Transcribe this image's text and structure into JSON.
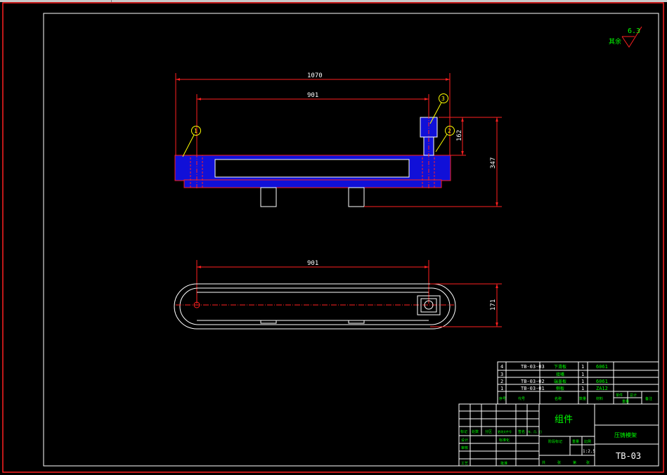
{
  "colors": {
    "background": "#000000",
    "border": "#ffffff",
    "sheet_frame": "#ff2020",
    "part_fill": "#1010d8",
    "dimension": "#ff2020",
    "outline": "#ffffff",
    "balloon": "#ffff00",
    "label_text": "#00ff00",
    "roughness_text": "#00ff00"
  },
  "roughness": {
    "value": "6.3",
    "label": "其余"
  },
  "dimensions": {
    "overall_length": "1070",
    "pitch_top": "901",
    "pitch_plan": "901",
    "height_stem": "162",
    "height_total": "347",
    "width_plan": "171"
  },
  "balloons": {
    "b1": "1",
    "b2": "2",
    "b3": "3"
  },
  "parts_list": [
    {
      "no": "4",
      "code": "TB-03-03",
      "name": "下滑板",
      "qty": "1",
      "material": "6061"
    },
    {
      "no": "3",
      "code": "",
      "name": "接嘴",
      "qty": "1",
      "material": ""
    },
    {
      "no": "2",
      "code": "TB-03-02",
      "name": "端盖板",
      "qty": "1",
      "material": "6061"
    },
    {
      "no": "1",
      "code": "TB-03-01",
      "name": "侧板",
      "qty": "1",
      "material": "ZA12"
    }
  ],
  "parts_header": {
    "no": "序号",
    "code": "代号",
    "name": "名称",
    "qty": "数量",
    "material": "材料",
    "unit": "单件",
    "total": "总计",
    "weight": "重量",
    "remark": "备注"
  },
  "title_block": {
    "title": "组件",
    "company": "压铸模架",
    "drawing_no": "TB-03",
    "scale": "1:2.5",
    "rev_mark": "标记",
    "rev_count": "处数",
    "rev_zone": "分区",
    "rev_doc": "更改文件号",
    "rev_sign": "签名",
    "rev_date": "年、月、日",
    "designer": "设计",
    "standardize": "标准化",
    "checker": "审核",
    "process": "工艺",
    "approve": "批准",
    "stage_mark": "阶段标记",
    "weight": "重量",
    "scale_label": "比例",
    "sheets_total": "共",
    "sheet_label": "张",
    "sheet_no": "第"
  }
}
